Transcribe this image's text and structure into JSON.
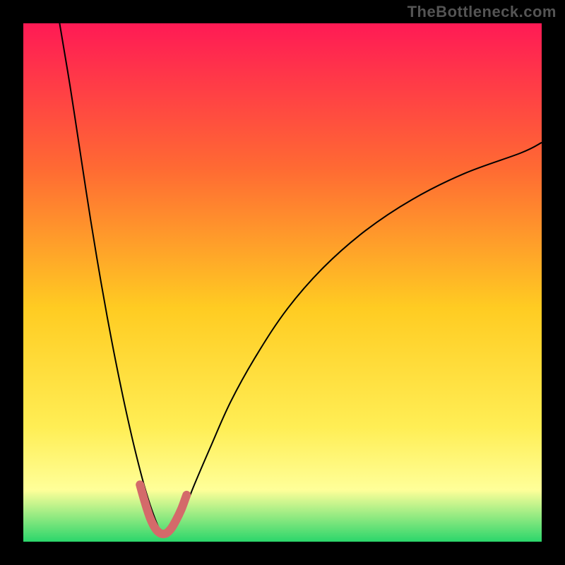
{
  "watermark": "TheBottleneck.com",
  "chart_data": {
    "type": "line",
    "title": "",
    "xlabel": "",
    "ylabel": "",
    "xlim": [
      0,
      100
    ],
    "ylim": [
      0,
      100
    ],
    "background_gradient": {
      "top": "#ff1a55",
      "upper_mid": "#ff6a33",
      "mid": "#ffcc22",
      "lower_mid": "#ffee55",
      "band": "#ffff99",
      "bottom": "#2bd66b"
    },
    "series": [
      {
        "name": "bottleneck-curve",
        "color": "#000000",
        "x": [
          7,
          9,
          11,
          13,
          15,
          17,
          19,
          21,
          23,
          24.5,
          26,
          27,
          28,
          29.5,
          31,
          33,
          36,
          40,
          45,
          51,
          58,
          66,
          75,
          85,
          96,
          100
        ],
        "y": [
          100,
          88,
          75,
          62,
          50,
          39,
          29,
          20,
          12,
          7,
          3,
          1.5,
          1.5,
          3,
          6,
          11,
          18,
          27,
          36,
          45,
          53,
          60,
          66,
          71,
          75,
          77
        ]
      },
      {
        "name": "highlight-segment",
        "color": "#d46a6a",
        "thick": true,
        "x": [
          22.5,
          23.5,
          24.5,
          25.5,
          26.5,
          27.5,
          28.5,
          29.5,
          30.5,
          31.5
        ],
        "y": [
          11,
          7.5,
          4.5,
          2.5,
          1.6,
          1.6,
          2.5,
          4.2,
          6.3,
          9
        ]
      }
    ],
    "frame": {
      "border_width_px": 33,
      "border_color": "#000000"
    }
  }
}
